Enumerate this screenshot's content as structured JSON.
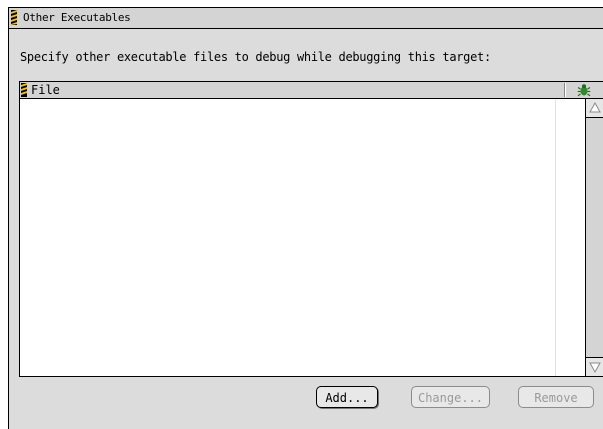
{
  "window": {
    "title": "Other Executables"
  },
  "instructions": "Specify other executable files to debug while debugging this target:",
  "file_list": {
    "columns": [
      {
        "label": "File",
        "icon": "hazard-stripe-icon"
      },
      {
        "label": "",
        "icon": "bug-icon"
      }
    ],
    "rows": []
  },
  "buttons": {
    "add_label": "Add...",
    "change_label": "Change...",
    "remove_label": "Remove"
  },
  "colors": {
    "panel": "#dcdcdc",
    "header": "#d4d4d4",
    "disabled_text": "#9a9a9a",
    "bug": "#2f8a2f"
  }
}
